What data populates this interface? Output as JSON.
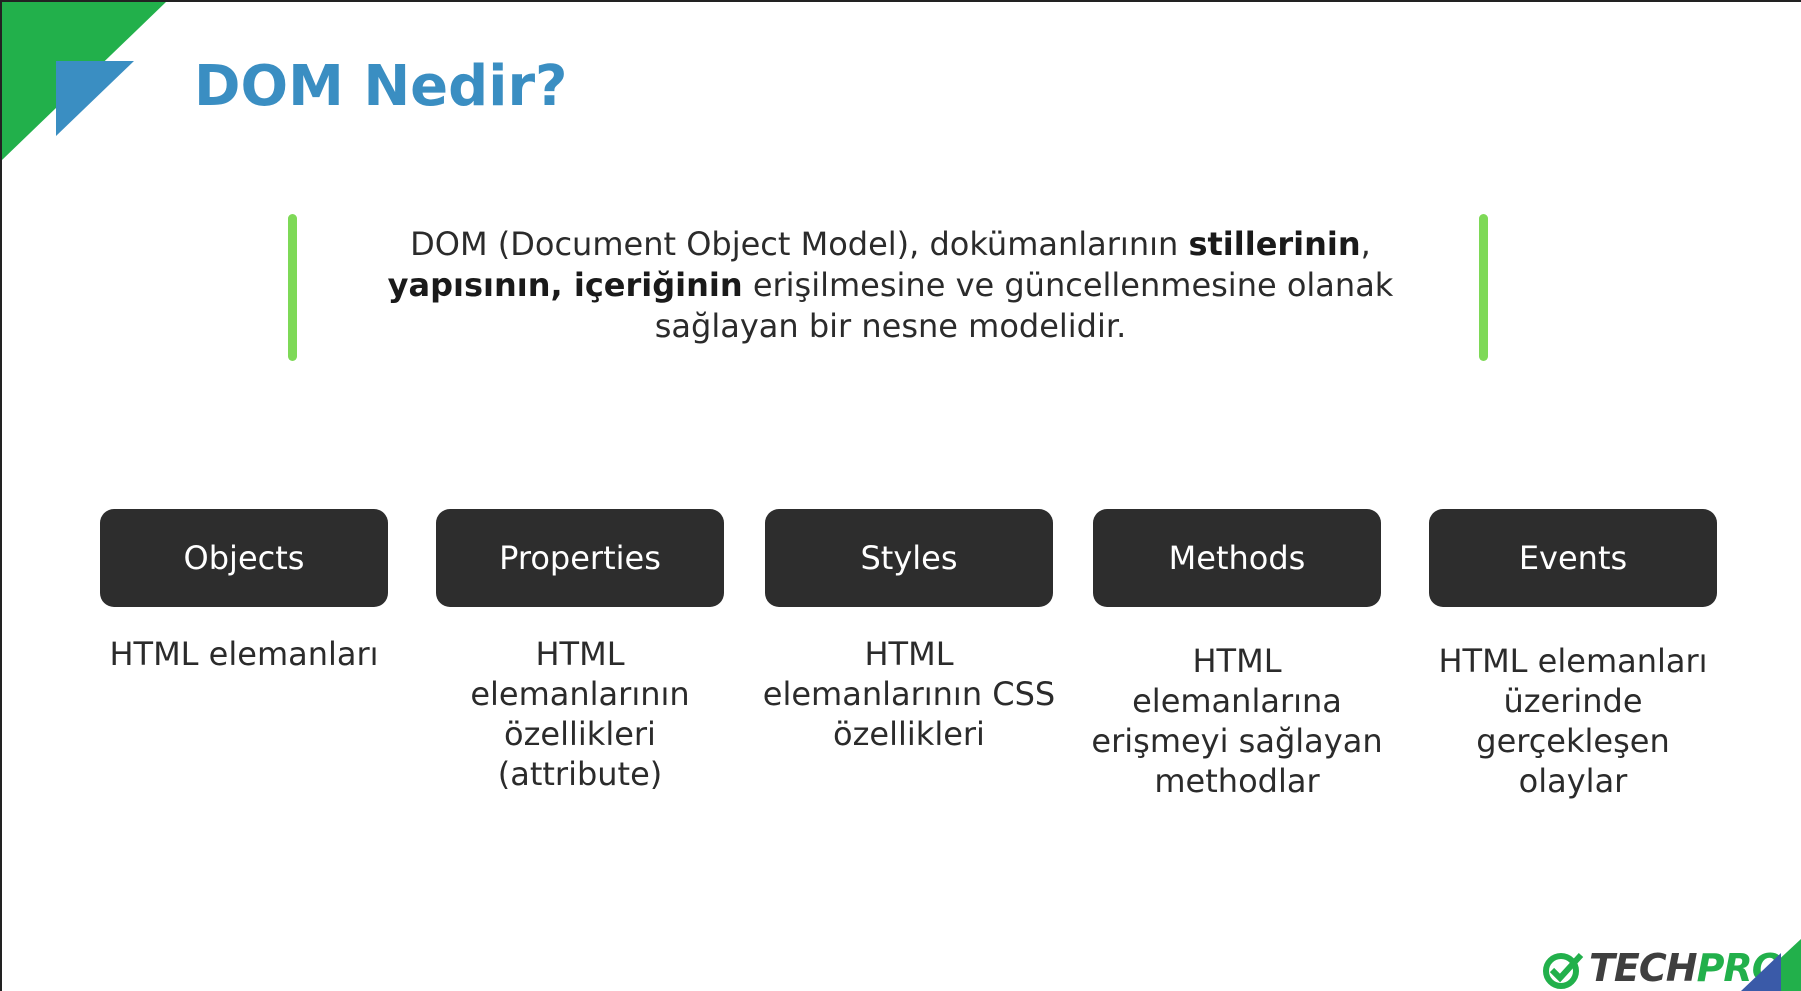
{
  "title": "DOM Nedir?",
  "definition": {
    "part1": "DOM (Document Object Model),  dokümanlarının ",
    "bold1": "stillerinin",
    "part2": ", ",
    "bold2": "yapısının, içeriğinin",
    "part3": " erişilmesine ve  güncellenmesine olanak sağlayan bir nesne modelidir."
  },
  "items": [
    {
      "label": "Objects",
      "desc": "HTML elemanları"
    },
    {
      "label": "Properties",
      "desc": "HTML elemanlarının özellikleri (attribute)"
    },
    {
      "label": "Styles",
      "desc": "HTML elemanlarının CSS özellikleri"
    },
    {
      "label": "Methods",
      "desc": "HTML elemanlarına erişmeyi sağlayan methodlar"
    },
    {
      "label": "Events",
      "desc": "HTML elemanları üzerinde gerçekleşen olaylar"
    }
  ],
  "logo": {
    "part1": "TECH",
    "part2": "PRO",
    "icon": "check-circle-icon"
  },
  "colors": {
    "title": "#3a8ec2",
    "accent_green": "#7ed957",
    "card_bg": "#2d2d2d",
    "corner_green": "#22b04b",
    "corner_blue": "#3a8ec2"
  }
}
